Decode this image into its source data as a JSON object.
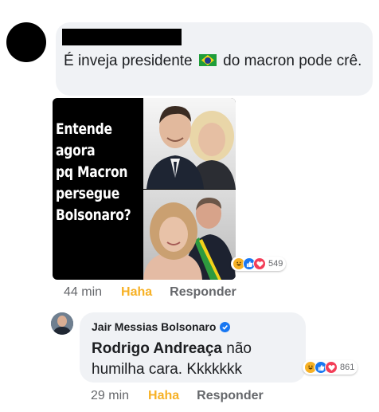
{
  "comment1": {
    "text_before_flag": "É inveja presidente",
    "flag_icon": "brazil-flag-icon",
    "text_after_flag": "do macron pode crê.",
    "meme_caption_lines": [
      "Entende",
      "agora",
      "pq Macron",
      "persegue",
      "Bolsonaro?"
    ],
    "reactions": [
      "haha",
      "like",
      "love"
    ],
    "reaction_count": "549",
    "time": "44 min",
    "haha_label": "Haha",
    "reply_label": "Responder"
  },
  "reply": {
    "author": "Jair Messias Bolsonaro",
    "mention": "Rodrigo Andreaça",
    "text": "não humilha cara. Kkkkkkk",
    "reactions": [
      "haha",
      "like",
      "love"
    ],
    "reaction_count": "861",
    "time": "29 min",
    "haha_label": "Haha",
    "reply_label": "Responder"
  },
  "colors": {
    "bubble": "#f0f2f5",
    "haha_accent": "#f7b125",
    "muted": "#65676b",
    "verified": "#1877f2"
  }
}
